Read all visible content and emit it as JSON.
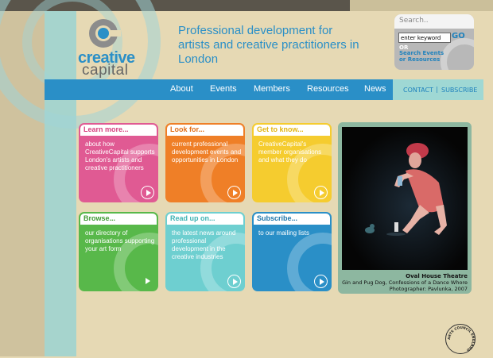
{
  "logo": {
    "word1": "creative",
    "word2": "capital"
  },
  "tagline": "Professional development for artists and creative practitioners in London",
  "search": {
    "heading": "Search..",
    "input_value": "enter keyword",
    "go_label": "GO",
    "or_label": "OR",
    "advanced_label": "Search Events or Resources"
  },
  "nav": {
    "items": [
      "About",
      "Events",
      "Members",
      "Resources",
      "News"
    ],
    "contact": "CONTACT",
    "separator": "|",
    "subscribe": "SUBSCRIBE"
  },
  "tiles": [
    {
      "heading": "Learn more...",
      "body": "about how CreativeCapital supports London's artists and creative practitioners",
      "color": "#e05a93",
      "head_color": "#d6417f"
    },
    {
      "heading": "Look for...",
      "body": "current professional development events and opportunities in London",
      "color": "#ef7f27",
      "head_color": "#e0701a"
    },
    {
      "heading": "Get to know...",
      "body": "CreativeCapital's member organisations and what they do",
      "color": "#f5cc2f",
      "head_color": "#e2b614"
    },
    {
      "heading": "Browse...",
      "body": "our directory of organisations supporting your art form",
      "color": "#58b84a",
      "head_color": "#3f9a33"
    },
    {
      "heading": "Read up on...",
      "body": "the latest news around professional development in the creative industries",
      "color": "#6ecfd0",
      "head_color": "#3fb3b4"
    },
    {
      "heading": "Subscribe...",
      "body": "to our mailing lists",
      "color": "#2a8fc7",
      "head_color": "#1f76aa"
    }
  ],
  "photo": {
    "venue": "Oval House Theatre",
    "credit_line1": "Gin and Pug Dog, Confessions of a Dance Whore",
    "credit_line2": "Photographer: Pavlunka, 2007"
  },
  "arts_council": "ARTS COUNCIL ENGLAND"
}
